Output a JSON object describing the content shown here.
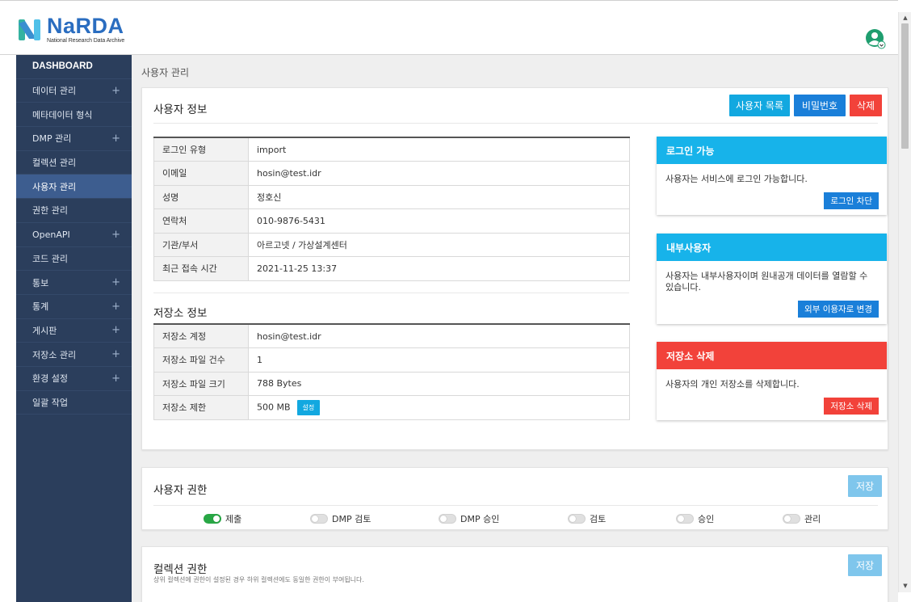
{
  "brand": {
    "name": "NaRDA",
    "subtitle": "National Research Data Archive"
  },
  "sidebar": {
    "items": [
      {
        "label": "DASHBOARD",
        "expandable": false
      },
      {
        "label": "데이터 관리",
        "expandable": true
      },
      {
        "label": "메타데이터 형식",
        "expandable": false
      },
      {
        "label": "DMP 관리",
        "expandable": true
      },
      {
        "label": "컬렉션 관리",
        "expandable": false
      },
      {
        "label": "사용자 관리",
        "expandable": false,
        "active": true
      },
      {
        "label": "권한 관리",
        "expandable": false
      },
      {
        "label": "OpenAPI",
        "expandable": true
      },
      {
        "label": "코드 관리",
        "expandable": false
      },
      {
        "label": "통보",
        "expandable": true
      },
      {
        "label": "통계",
        "expandable": true
      },
      {
        "label": "게시판",
        "expandable": true
      },
      {
        "label": "저장소 관리",
        "expandable": true
      },
      {
        "label": "환경 설정",
        "expandable": true
      },
      {
        "label": "일괄 작업",
        "expandable": false
      }
    ],
    "plus_symbol": "+"
  },
  "breadcrumb": "사용자 관리",
  "user_info": {
    "title": "사용자 정보",
    "buttons": {
      "list": "사용자 목록",
      "password": "비밀번호",
      "delete": "삭제"
    },
    "rows": [
      {
        "key": "로그인 유형",
        "value": "import"
      },
      {
        "key": "이메일",
        "value": "hosin@test.idr"
      },
      {
        "key": "성명",
        "value": "정호신"
      },
      {
        "key": "연락처",
        "value": "010-9876-5431"
      },
      {
        "key": "기관/부서",
        "value": "아르고넷 / 가상설계센터"
      },
      {
        "key": "최근 접속 시간",
        "value": "2021-11-25 13:37"
      }
    ]
  },
  "storage_info": {
    "title": "저장소 정보",
    "rows": [
      {
        "key": "저장소 계정",
        "value": "hosin@test.idr"
      },
      {
        "key": "저장소 파일 건수",
        "value": "1"
      },
      {
        "key": "저장소 파일 크기",
        "value": "788 Bytes"
      },
      {
        "key": "저장소 제한",
        "value": "500 MB"
      }
    ],
    "setting_button": "설정"
  },
  "panels": {
    "login": {
      "title": "로그인 가능",
      "text": "사용자는 서비스에 로그인 가능합니다.",
      "button": "로그인 차단"
    },
    "internal": {
      "title": "내부사용자",
      "text": "사용자는 내부사용자이며 원내공개 데이터를 열람할 수 있습니다.",
      "button": "외부 이용자로 변경"
    },
    "storage_delete": {
      "title": "저장소 삭제",
      "text": "사용자의 개인 저장소를 삭제합니다.",
      "button": "저장소 삭제"
    }
  },
  "permissions": {
    "title": "사용자 권한",
    "save": "저장",
    "toggles": [
      {
        "label": "제출",
        "on": true
      },
      {
        "label": "DMP 검토",
        "on": false
      },
      {
        "label": "DMP 승인",
        "on": false
      },
      {
        "label": "검토",
        "on": false
      },
      {
        "label": "승인",
        "on": false
      },
      {
        "label": "관리",
        "on": false
      }
    ]
  },
  "collection_permissions": {
    "title": "컬렉션 권한",
    "note": "상위 컬렉션에 권한이 설정된 경우 하위 컬렉션에도 동일한 권한이 부여됩니다.",
    "save": "저장"
  },
  "colors": {
    "sidebar": "#2b3e5c",
    "active": "#3d5d8f",
    "cyan": "#12a8e0",
    "blue": "#1a7fd9",
    "red": "#f2423a",
    "toggle_on": "#28a745"
  },
  "icons": {
    "user": "user-account-icon",
    "plus": "plus-icon"
  }
}
